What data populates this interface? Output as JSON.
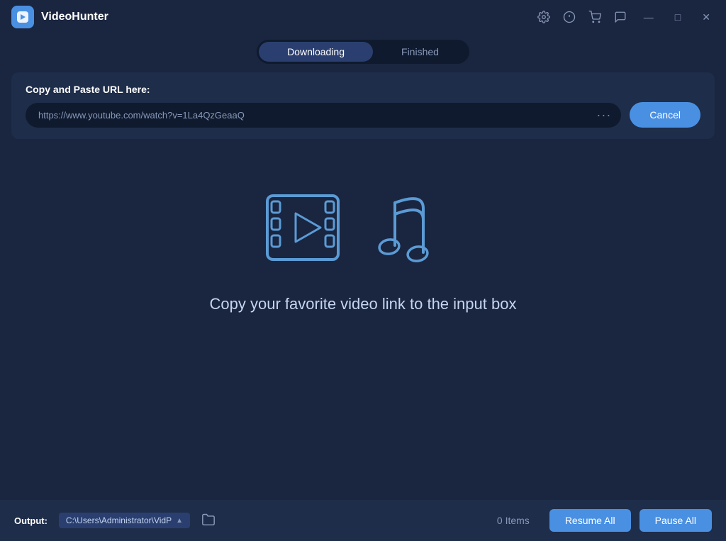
{
  "app": {
    "title": "VideoHunter",
    "logo_alt": "VideoHunter Logo"
  },
  "titlebar": {
    "icons": [
      "settings-icon",
      "info-icon",
      "cart-icon",
      "chat-icon"
    ],
    "window_controls": [
      "minimize-btn",
      "maximize-btn",
      "close-btn"
    ]
  },
  "tabs": {
    "downloading_label": "Downloading",
    "finished_label": "Finished",
    "active": "downloading"
  },
  "url_section": {
    "label": "Copy and Paste URL here:",
    "placeholder": "https://www.youtube.com/watch?v=1La4QzGeaaQ",
    "value": "https://www.youtube.com/watch?v=1La4QzGeaaQ",
    "cancel_btn": "Cancel"
  },
  "illustration": {
    "text": "Copy your favorite video link to the input box"
  },
  "bottom_bar": {
    "output_label": "Output:",
    "output_path": "C:\\Users\\Administrator\\VidP",
    "items_count": "0 Items",
    "resume_all_btn": "Resume All",
    "pause_all_btn": "Pause All"
  }
}
